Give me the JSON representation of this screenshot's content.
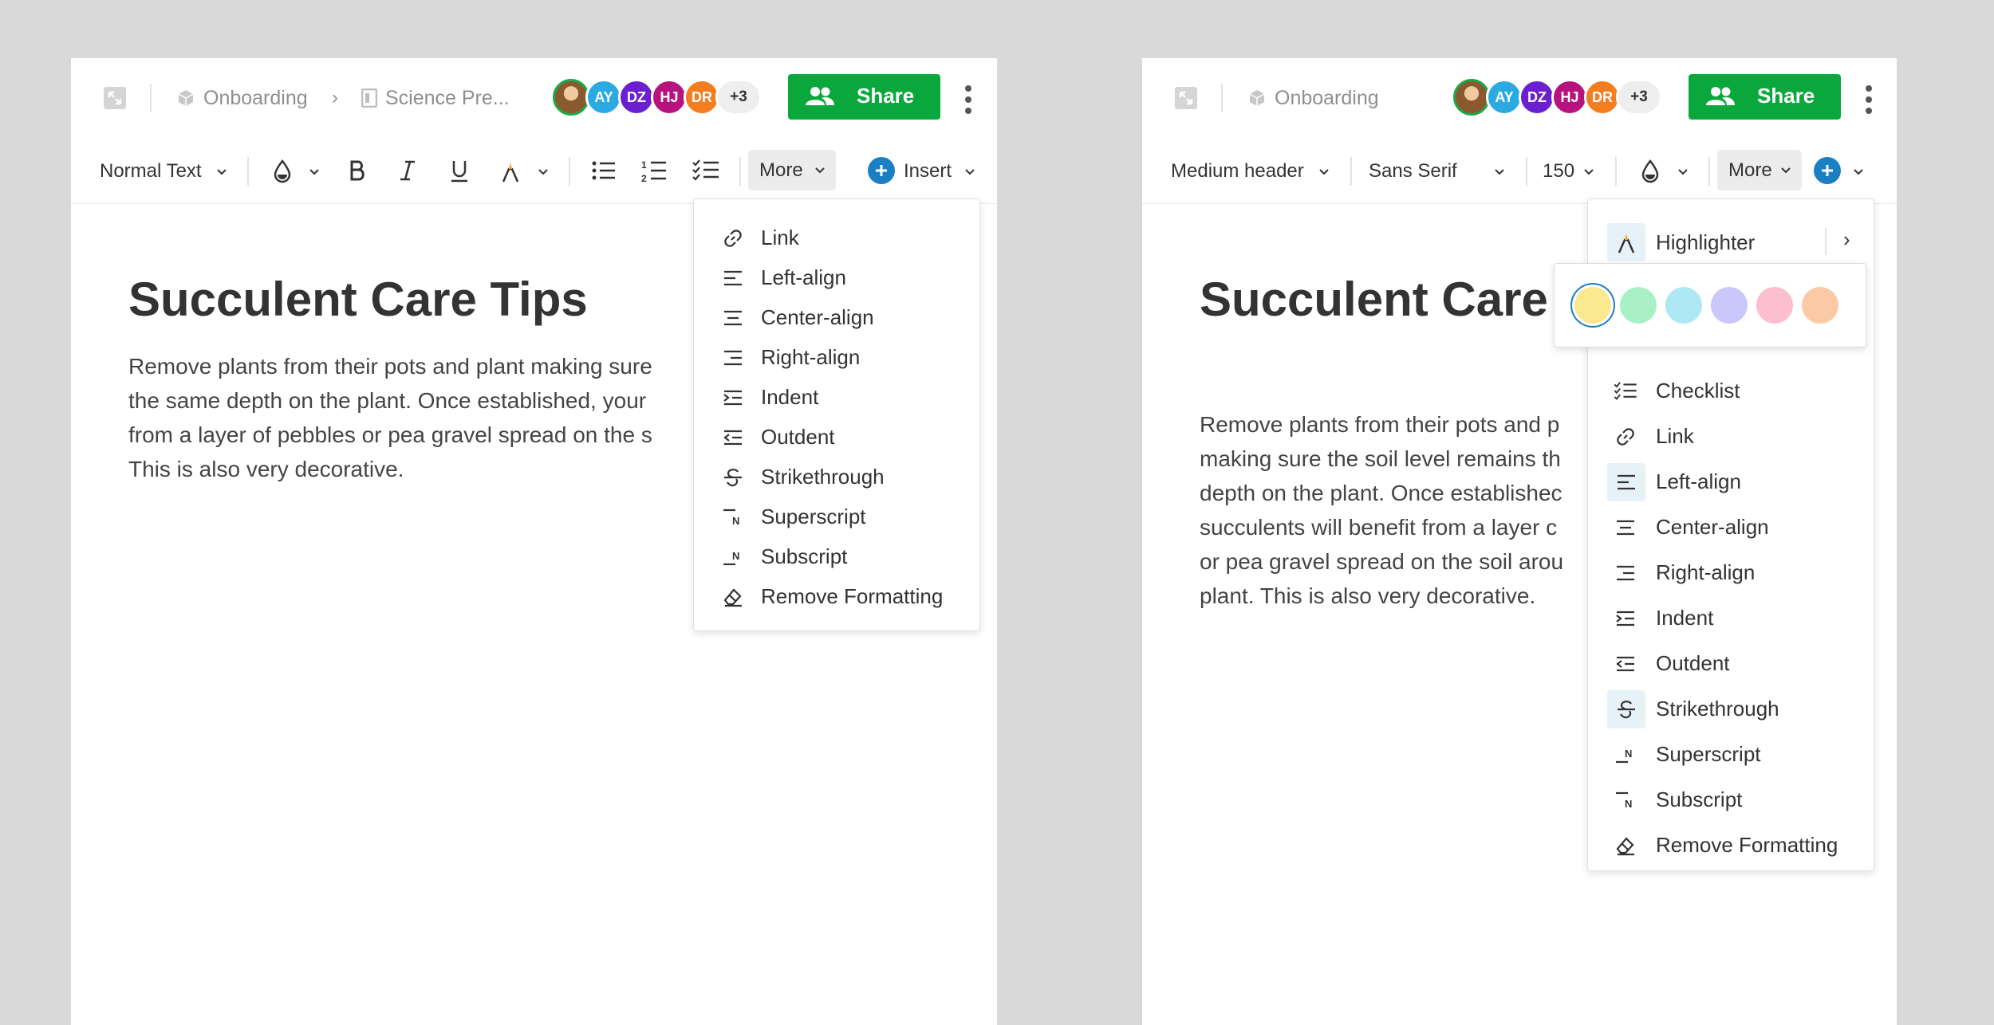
{
  "left": {
    "breadcrumb": {
      "workspace": "Onboarding",
      "separator": "›",
      "document": "Science Pre..."
    },
    "avatars": [
      {
        "initials": "",
        "color": "#8a5a2e"
      },
      {
        "initials": "AY",
        "color": "#29abe2"
      },
      {
        "initials": "DZ",
        "color": "#6a1fd1"
      },
      {
        "initials": "HJ",
        "color": "#b8127e"
      },
      {
        "initials": "DR",
        "color": "#f47d20"
      }
    ],
    "avatar_more": "+3",
    "share_label": "Share",
    "toolbar": {
      "text_style": "Normal Text",
      "more_label": "More",
      "insert_label": "Insert"
    },
    "doc": {
      "title": "Succulent Care Tips",
      "lines": [
        "Remove plants from their pots and plant making sure",
        "the same depth on the plant. Once established, your",
        "from a layer of pebbles or pea gravel spread on the s",
        "This is also very decorative."
      ]
    },
    "menu": [
      {
        "label": "Link",
        "icon": "link-icon"
      },
      {
        "label": "Left-align",
        "icon": "align-left-icon"
      },
      {
        "label": "Center-align",
        "icon": "align-center-icon"
      },
      {
        "label": "Right-align",
        "icon": "align-right-icon"
      },
      {
        "label": "Indent",
        "icon": "indent-icon"
      },
      {
        "label": "Outdent",
        "icon": "outdent-icon"
      },
      {
        "label": "Strikethrough",
        "icon": "strikethrough-icon"
      },
      {
        "label": "Superscript",
        "icon": "superscript-icon"
      },
      {
        "label": "Subscript",
        "icon": "subscript-icon"
      },
      {
        "label": "Remove Formatting",
        "icon": "eraser-icon"
      }
    ]
  },
  "right": {
    "breadcrumb": {
      "workspace": "Onboarding"
    },
    "avatar_more": "+3",
    "share_label": "Share",
    "toolbar": {
      "text_style": "Medium header",
      "font": "Sans Serif",
      "size": "150",
      "more_label": "More"
    },
    "doc": {
      "title": "Succulent Care",
      "lines": [
        "Remove plants from their pots and p",
        "making sure the soil level remains th",
        "depth on the plant. Once establishec",
        "succulents will benefit from a layer c",
        "or pea gravel spread on the soil arou",
        "plant. This is also very decorative."
      ]
    },
    "highlighter": {
      "label": "Highlighter",
      "arrow": "›"
    },
    "swatches": [
      "#fbe98f",
      "#a9f0c6",
      "#aee9f3",
      "#cac8fb",
      "#fbbfd0",
      "#fcc9a7"
    ],
    "menu": [
      {
        "label": "Checklist",
        "icon": "checklist-icon"
      },
      {
        "label": "Link",
        "icon": "link-icon"
      },
      {
        "label": "Left-align",
        "icon": "align-left-icon"
      },
      {
        "label": "Center-align",
        "icon": "align-center-icon"
      },
      {
        "label": "Right-align",
        "icon": "align-right-icon"
      },
      {
        "label": "Indent",
        "icon": "indent-icon"
      },
      {
        "label": "Outdent",
        "icon": "outdent-icon"
      },
      {
        "label": "Strikethrough",
        "icon": "strikethrough-icon"
      },
      {
        "label": "Superscript",
        "icon": "superscript-icon"
      },
      {
        "label": "Subscript",
        "icon": "subscript-icon"
      },
      {
        "label": "Remove Formatting",
        "icon": "eraser-icon"
      }
    ]
  },
  "colors": {
    "share_green": "#0aa83c",
    "accent_blue": "#1b7fc4",
    "highlighter_orange": "#f5a623"
  }
}
